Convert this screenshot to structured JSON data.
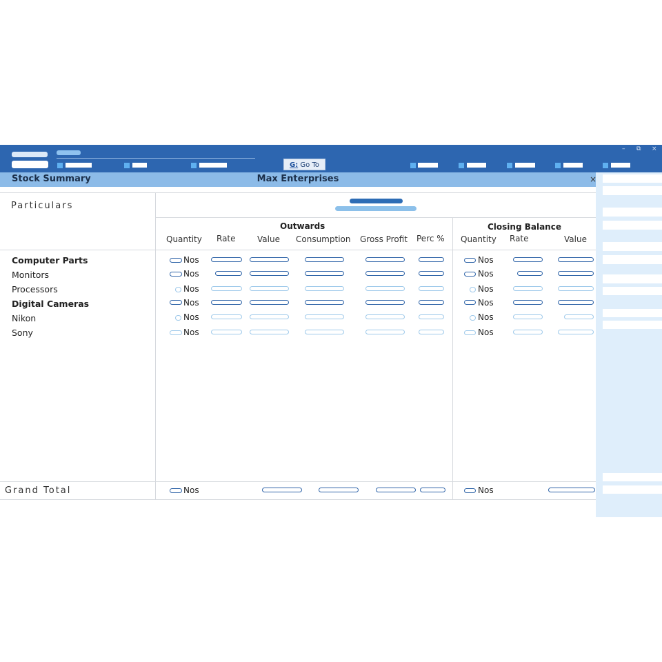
{
  "topbar": {
    "goto_key": "G:",
    "goto_label": "Go To",
    "window_controls": {
      "minimize": "–",
      "restore": "⧉",
      "close": "×"
    }
  },
  "report": {
    "title": "Stock Summary",
    "company": "Max Enterprises",
    "close": "×"
  },
  "columns": {
    "particulars": "Particulars",
    "group_outwards": "Outwards",
    "group_closing": "Closing Balance",
    "outwards": [
      "Quantity",
      "Rate",
      "Value",
      "Consumption",
      "Gross Profit",
      "Perc %"
    ],
    "closing": [
      "Quantity",
      "Rate",
      "Value"
    ]
  },
  "rows": [
    {
      "name": "Computer Parts",
      "bold": true,
      "unit": "Nos"
    },
    {
      "name": "Monitors",
      "bold": false,
      "unit": "Nos"
    },
    {
      "name": "Processors",
      "bold": false,
      "unit": "Nos"
    },
    {
      "name": "Digital Cameras",
      "bold": true,
      "unit": "Nos"
    },
    {
      "name": "Nikon",
      "bold": false,
      "unit": "Nos"
    },
    {
      "name": "Sony",
      "bold": false,
      "unit": "Nos"
    }
  ],
  "grand_total": {
    "label": "Grand Total",
    "outwards_unit": "Nos",
    "closing_unit": "Nos"
  },
  "colors": {
    "topbar": "#2d66b0",
    "titlebar": "#8cbbe8",
    "sidebar": "#dfeefb",
    "placeholder_dark": "#2f64a8",
    "placeholder_light": "#9ec9ea"
  }
}
